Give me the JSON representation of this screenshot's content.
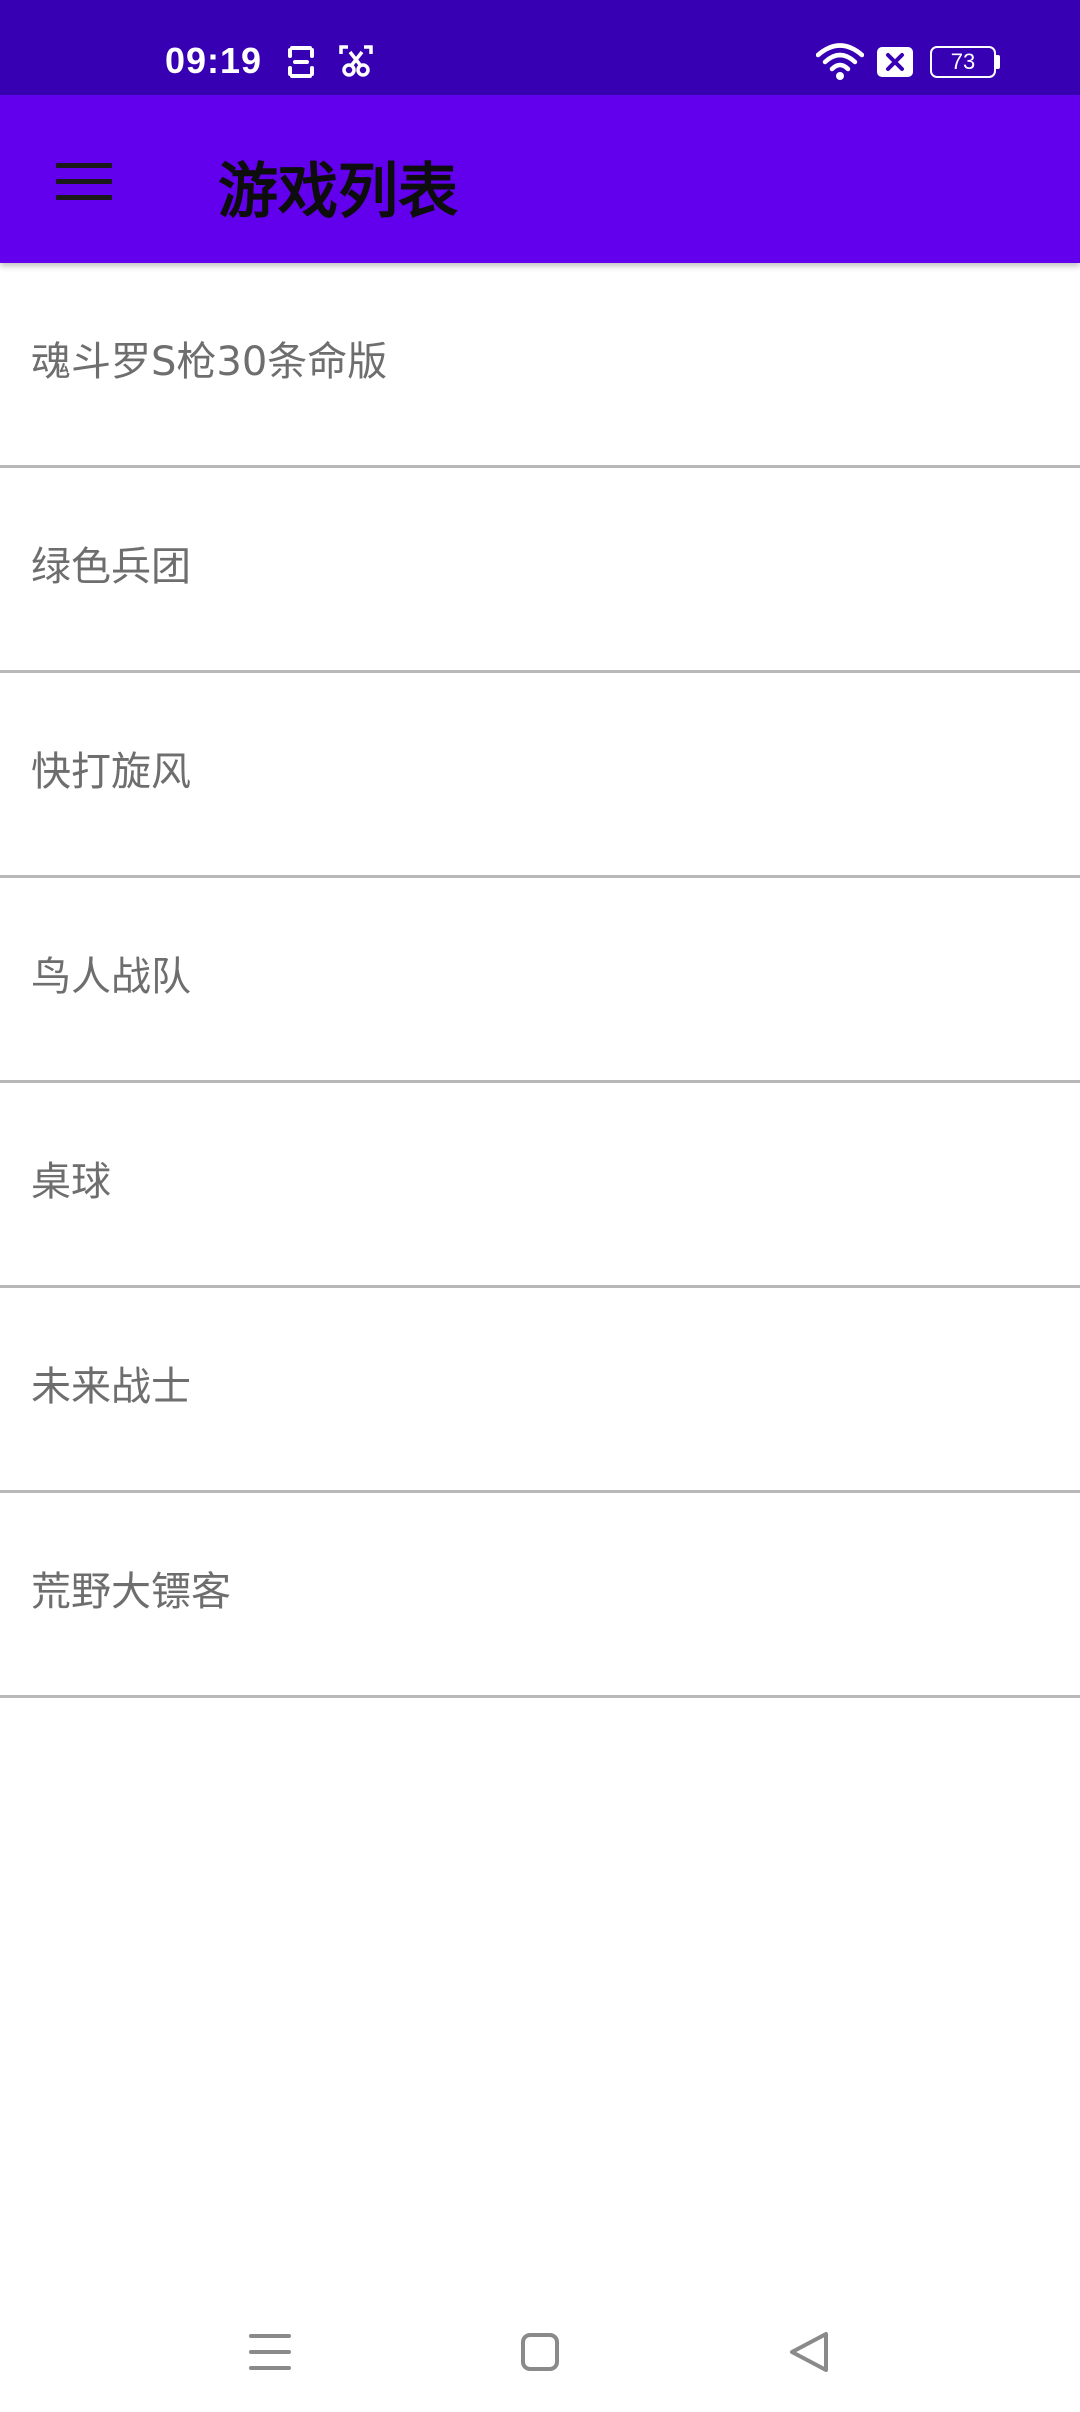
{
  "status_bar": {
    "time": "09:19",
    "icons": [
      "face-unlock-icon",
      "screenshot-icon",
      "wifi-icon",
      "sim-x-icon"
    ],
    "battery": "73"
  },
  "app_bar": {
    "title": "游戏列表",
    "menu_icon": "hamburger-menu-icon"
  },
  "games": [
    {
      "label": "魂斗罗S枪30条命版"
    },
    {
      "label": "绿色兵团"
    },
    {
      "label": "快打旋风"
    },
    {
      "label": "鸟人战队"
    },
    {
      "label": "桌球"
    },
    {
      "label": "未来战士"
    },
    {
      "label": "荒野大镖客"
    }
  ],
  "nav_bar": {
    "buttons": [
      "recents-icon",
      "home-icon",
      "back-icon"
    ]
  },
  "colors": {
    "status_bar": "#3700B3",
    "app_bar": "#6200EE",
    "item_text": "#6e6e6e",
    "divider": "#b8b8b8"
  }
}
